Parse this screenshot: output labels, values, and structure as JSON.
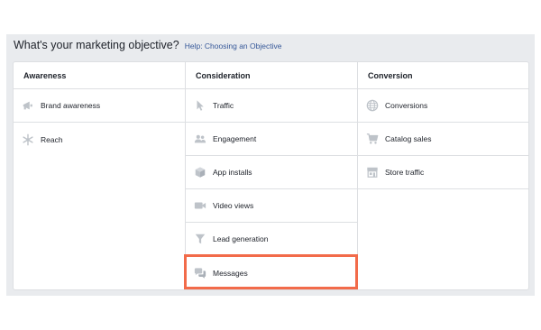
{
  "header": {
    "title": "What's your marketing objective?",
    "help_link": "Help: Choosing an Objective"
  },
  "colors": {
    "panel_bg": "#e9ebee",
    "link": "#365899",
    "icon": "#bec3c9",
    "highlight": "#f26b4a"
  },
  "columns": [
    {
      "title": "Awareness",
      "items": [
        {
          "label": "Brand awareness",
          "icon": "megaphone-icon"
        },
        {
          "label": "Reach",
          "icon": "snowflake-icon"
        }
      ]
    },
    {
      "title": "Consideration",
      "items": [
        {
          "label": "Traffic",
          "icon": "cursor-icon"
        },
        {
          "label": "Engagement",
          "icon": "people-icon"
        },
        {
          "label": "App installs",
          "icon": "cube-icon"
        },
        {
          "label": "Video views",
          "icon": "video-camera-icon"
        },
        {
          "label": "Lead generation",
          "icon": "funnel-icon"
        },
        {
          "label": "Messages",
          "icon": "chat-bubbles-icon"
        }
      ]
    },
    {
      "title": "Conversion",
      "items": [
        {
          "label": "Conversions",
          "icon": "globe-icon"
        },
        {
          "label": "Catalog sales",
          "icon": "shopping-cart-icon"
        },
        {
          "label": "Store traffic",
          "icon": "store-icon"
        }
      ]
    }
  ],
  "highlighted_item": "Messages"
}
